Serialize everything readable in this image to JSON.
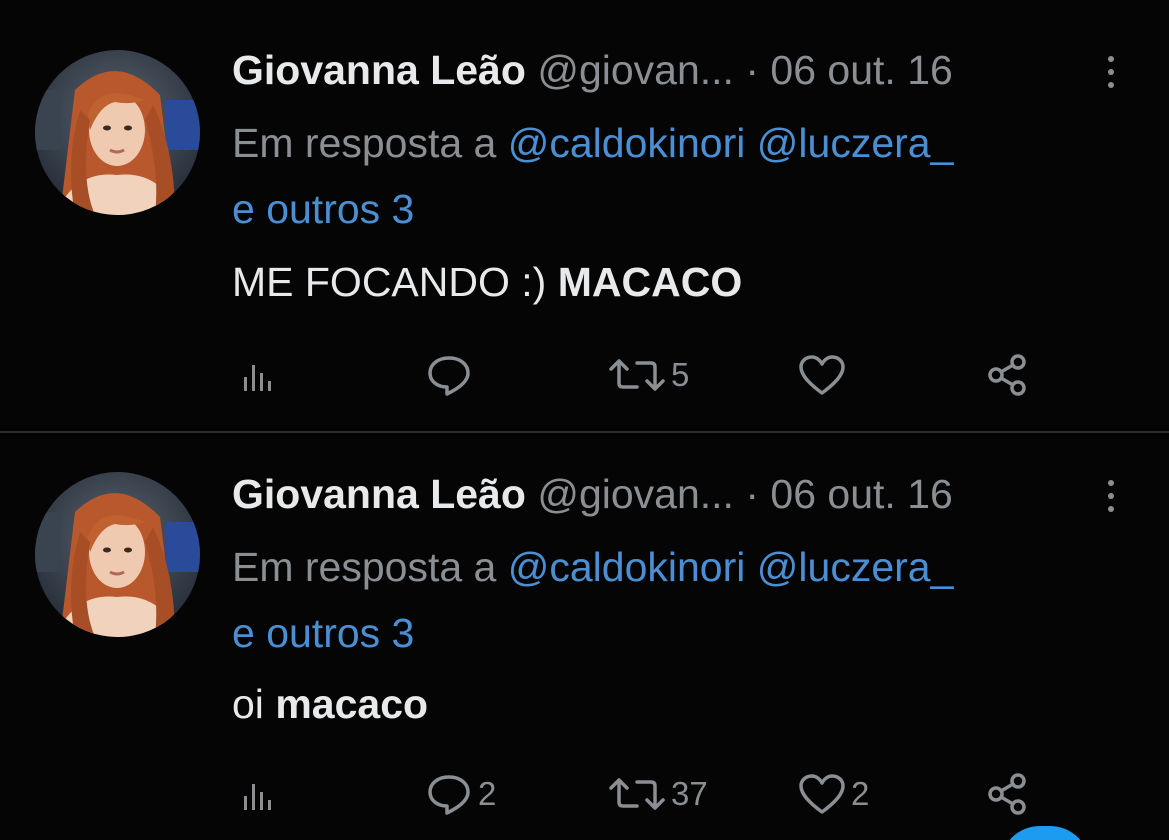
{
  "tweets": [
    {
      "author": {
        "name": "Giovanna Leão",
        "handle": "@giovan...",
        "avatar_icon": "profile-photo"
      },
      "separator": "·",
      "date": "06 out. 16",
      "reply_prefix": "Em resposta a",
      "mentions": [
        "@caldokinori",
        "@luczera_"
      ],
      "others": "e outros 3",
      "text_normal": "ME FOCANDO :)",
      "text_bold": "MACACO",
      "actions": {
        "views_icon": "bar-chart-icon",
        "reply_count": "",
        "retweet_count": "5",
        "like_count": ""
      }
    },
    {
      "author": {
        "name": "Giovanna Leão",
        "handle": "@giovan...",
        "avatar_icon": "profile-photo"
      },
      "separator": "·",
      "date": "06 out. 16",
      "reply_prefix": "Em resposta a",
      "mentions": [
        "@caldokinori",
        "@luczera_"
      ],
      "others": "e outros 3",
      "text_normal": "oi",
      "text_bold": "macaco",
      "actions": {
        "views_icon": "bar-chart-icon",
        "reply_count": "2",
        "retweet_count": "37",
        "like_count": "2"
      }
    }
  ],
  "colors": {
    "background": "#000000",
    "text": "#e7e9ea",
    "secondary_text": "#8a8f94",
    "link": "#4a8fd4",
    "divider": "#2a2d30",
    "accent": "#1d9bf0"
  }
}
